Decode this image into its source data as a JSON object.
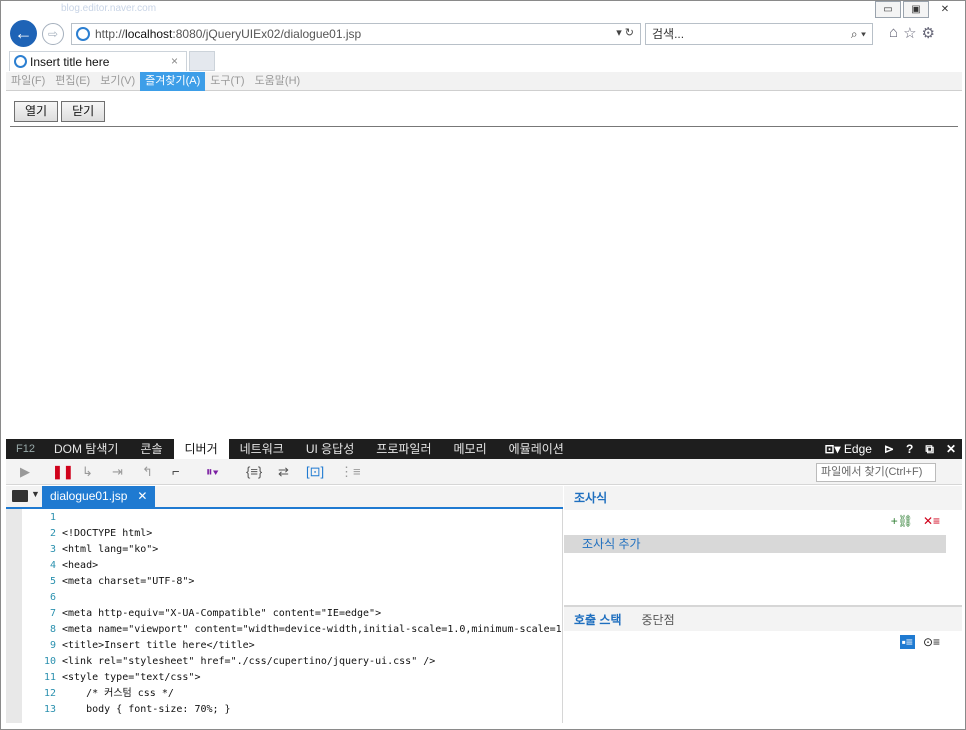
{
  "window": {
    "ghost_url": "blog.editor.naver.com",
    "buttons": {
      "minimize": "▭",
      "maximize": "▣",
      "close": "✕"
    }
  },
  "nav": {
    "back": "←",
    "forward": "⇨",
    "url_prefix": "http://",
    "url_host": "localhost",
    "url_rest": ":8080/jQueryUIEx02/dialogue01.jsp",
    "url_tools": "▾ ↻",
    "search_placeholder": "검색...",
    "search_icon": "⌕ ▾",
    "home_icon": "⌂",
    "favorites_icon": "☆",
    "settings_icon": "⚙"
  },
  "tab": {
    "title": "Insert title here",
    "close": "×"
  },
  "menu": {
    "items": [
      {
        "label": "파일(F)",
        "active": false
      },
      {
        "label": "편집(E)",
        "active": false
      },
      {
        "label": "보기(V)",
        "active": false
      },
      {
        "label": "즐겨찾기(A)",
        "active": true
      },
      {
        "label": "도구(T)",
        "active": false
      },
      {
        "label": "도움말(H)",
        "active": false
      }
    ]
  },
  "page": {
    "open_button": "열기",
    "close_button": "닫기"
  },
  "devtools": {
    "f12": "F12",
    "tabs": [
      "DOM 탐색기",
      "콘솔",
      "디버거",
      "네트워크",
      "UI 응답성",
      "프로파일러",
      "메모리",
      "에뮬레이션"
    ],
    "active_tab": "디버거",
    "mode": "Edge",
    "help": "?",
    "find_placeholder": "파일에서 찾기(Ctrl+F)",
    "file_tab": "dialogue01.jsp",
    "file_tab_close": "✕",
    "code_lines": [
      {
        "n": "1",
        "text": ""
      },
      {
        "n": "2",
        "text": "<!DOCTYPE html>"
      },
      {
        "n": "3",
        "text": "<html lang=\"ko\">"
      },
      {
        "n": "4",
        "text": "<head>"
      },
      {
        "n": "5",
        "text": "<meta charset=\"UTF-8\">"
      },
      {
        "n": "6",
        "text": ""
      },
      {
        "n": "7",
        "text": "<meta http-equiv=\"X-UA-Compatible\" content=\"IE=edge\">"
      },
      {
        "n": "8",
        "text": "<meta name=\"viewport\" content=\"width=device-width,initial-scale=1.0,minimum-scale=1"
      },
      {
        "n": "9",
        "text": "<title>Insert title here</title>"
      },
      {
        "n": "10",
        "text": "<link rel=\"stylesheet\" href=\"./css/cupertino/jquery-ui.css\" />"
      },
      {
        "n": "11",
        "text": "<style type=\"text/css\">"
      },
      {
        "n": "12",
        "text": "    /* 커스텀 css */"
      },
      {
        "n": "13",
        "text": "    body { font-size: 70%; }"
      }
    ],
    "watch_title": "조사식",
    "watch_add": "조사식 추가",
    "callstack_tab": "호출 스택",
    "breakpoints_tab": "중단점"
  },
  "colors": {
    "accent": "#1f7ad1",
    "menu_active": "#3d9ee8",
    "devtools_bar": "#1e1e1e"
  }
}
